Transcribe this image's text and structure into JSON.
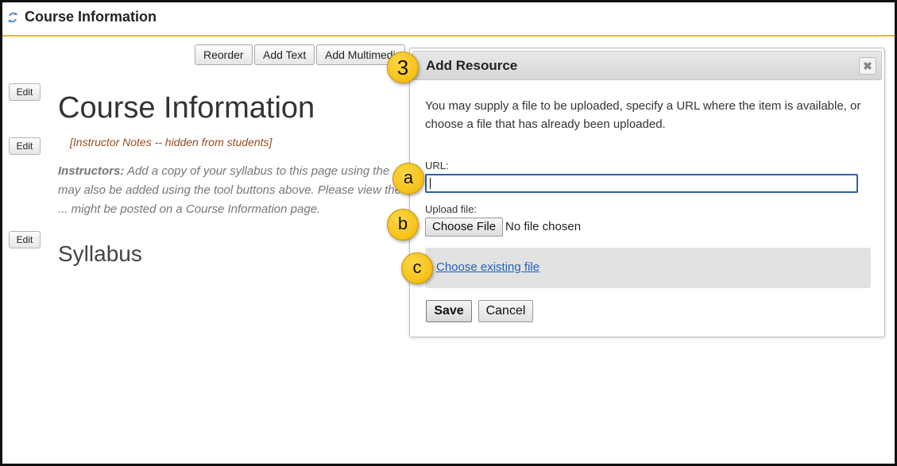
{
  "header": {
    "title": "Course Information",
    "icon": "refresh-arrows-icon"
  },
  "toolbar": {
    "reorder_label": "Reorder",
    "add_text_label": "Add Text",
    "add_multimedia_label": "Add Multimedia"
  },
  "content": {
    "edit_label": "Edit",
    "page_title": "Course Information",
    "instructor_notes": "[Instructor Notes -- hidden from students]",
    "instructors_label": "Instructors:",
    "instructors_text": " Add a copy of your syllabus to this page using the ... may also be added using the tool buttons above. Please view the ... might be posted on a Course Information page.",
    "syllabus_heading": "Syllabus"
  },
  "dialog": {
    "title": "Add Resource",
    "close_icon": "close-x-icon",
    "description": "You may supply a file to be uploaded, specify a URL where the item is available, or choose a file that has already been uploaded.",
    "url_label": "URL:",
    "url_value": "",
    "upload_label": "Upload file:",
    "choose_file_label": "Choose File",
    "no_file_text": "No file chosen",
    "existing_link": "Choose existing file",
    "save_label": "Save",
    "cancel_label": "Cancel"
  },
  "callouts": {
    "step": "3",
    "a": "a",
    "b": "b",
    "c": "c"
  },
  "colors": {
    "accent_rule": "#e8b63a",
    "marker": "#f2b500",
    "link": "#2161b8",
    "notes": "#9a4a1f"
  }
}
